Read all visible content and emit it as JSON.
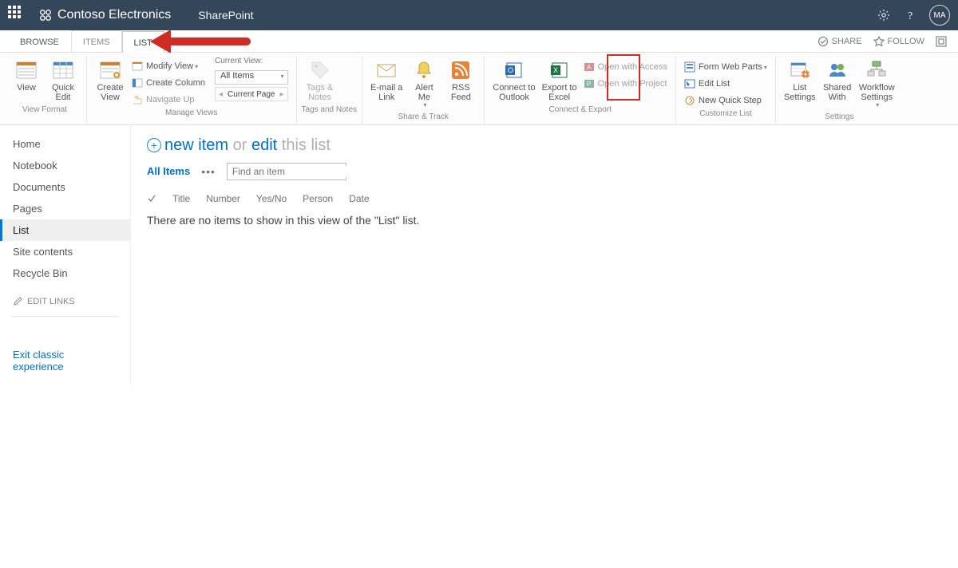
{
  "header": {
    "tenant": "Contoso Electronics",
    "app": "SharePoint",
    "avatar": "MA"
  },
  "tabs": {
    "browse": "BROWSE",
    "items": "ITEMS",
    "list": "LIST"
  },
  "topActions": {
    "share": "SHARE",
    "follow": "FOLLOW"
  },
  "ribbon": {
    "viewFormat": {
      "label": "View Format",
      "view": "View",
      "quickEdit": "Quick\nEdit"
    },
    "manageViews": {
      "label": "Manage Views",
      "createView": "Create\nView",
      "modifyView": "Modify View",
      "createColumn": "Create Column",
      "navigateUp": "Navigate Up",
      "currentViewLabel": "Current View:",
      "currentView": "All Items",
      "currentPage": "Current Page"
    },
    "tagsNotes": {
      "label": "Tags and Notes",
      "btn": "Tags &\nNotes"
    },
    "shareTrack": {
      "label": "Share & Track",
      "email": "E-mail a\nLink",
      "alert": "Alert\nMe",
      "rss": "RSS\nFeed"
    },
    "connectExport": {
      "label": "Connect & Export",
      "outlook": "Connect to\nOutlook",
      "excel": "Export to\nExcel",
      "openAccess": "Open with Access",
      "openProject": "Open with Project"
    },
    "customize": {
      "label": "Customize List",
      "formWebParts": "Form Web Parts",
      "editList": "Edit List",
      "newQuickStep": "New Quick Step"
    },
    "settings": {
      "label": "Settings",
      "listSettings": "List\nSettings",
      "sharedWith": "Shared\nWith",
      "workflow": "Workflow\nSettings"
    }
  },
  "leftnav": {
    "items": [
      "Home",
      "Notebook",
      "Documents",
      "Pages",
      "List",
      "Site contents",
      "Recycle Bin"
    ],
    "editLinks": "EDIT LINKS",
    "exit": "Exit classic experience"
  },
  "main": {
    "newItem": "new item",
    "or": "or",
    "edit": "edit",
    "thisList": "this list",
    "viewName": "All Items",
    "searchPlaceholder": "Find an item",
    "columns": [
      "Title",
      "Number",
      "Yes/No",
      "Person",
      "Date"
    ],
    "emptyMsg": "There are no items to show in this view of the \"List\" list."
  }
}
